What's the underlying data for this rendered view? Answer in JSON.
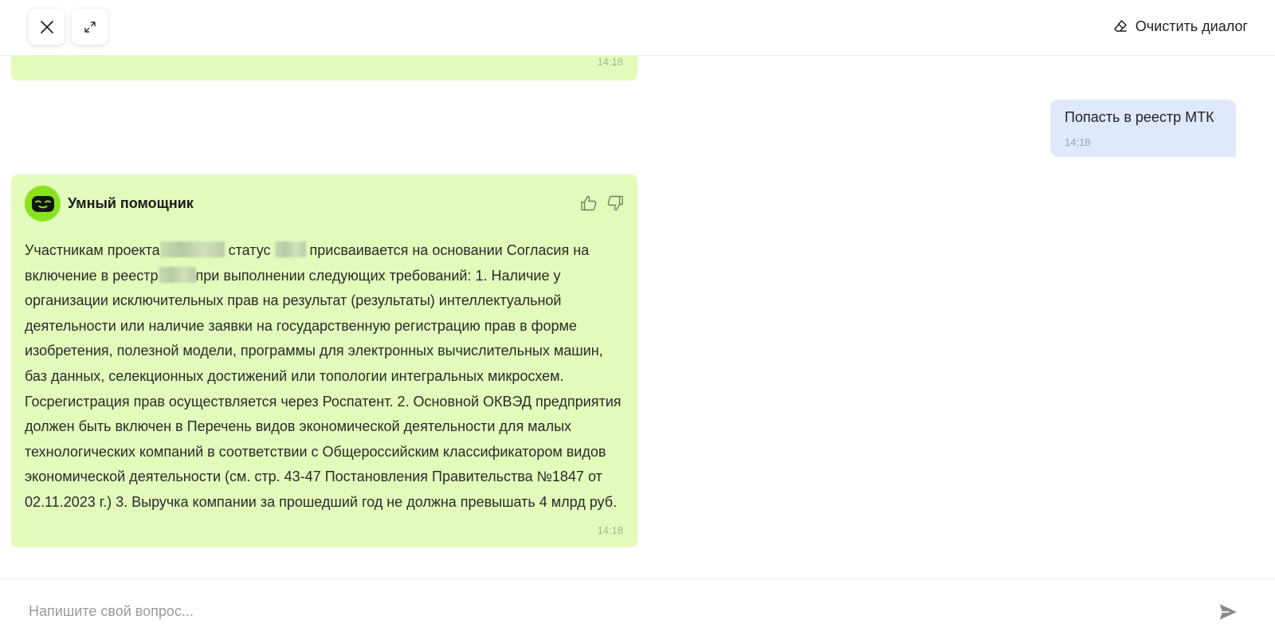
{
  "header": {
    "close_icon": "close-icon",
    "expand_icon": "expand-icon",
    "clear_label": "Очистить диалог",
    "clear_icon": "eraser-icon"
  },
  "messages": {
    "top_bot_time": "14:18",
    "user": {
      "text": "Попасть в реестр МТК",
      "time": "14:18"
    },
    "bot": {
      "name": "Умный помощник",
      "time": "14:18",
      "text_parts": [
        "Участникам проекта",
        " статус ",
        " присваивается на основании Согласия на включение в реестр",
        "при выполнении следующих требований: 1. Наличие у организации исключительных прав на результат (результаты) интеллектуальной деятельности или наличие заявки на государственную регистрацию прав в форме изобретения, полезной модели, программы для электронных вычислительных машин, баз данных, селекционных достижений или топологии интегральных микросхем. Госрегистрация прав осуществляется через Роспатент. 2. Основной ОКВЭД предприятия должен быть включен в Перечень видов экономической деятельности для малых технологических компаний в соответствии с Общероссийским классификатором видов экономической деятельности (см. стр. 43-47 Постановления Правительства №1847 от 02.11.2023 г.) 3. Выручка компании за прошедший год не должна превышать 4 млрд руб."
      ]
    }
  },
  "footer": {
    "placeholder": "Напишите свой вопрос...",
    "value": ""
  },
  "colors": {
    "bot_bubble": "#e2fbbb",
    "user_bubble": "#dfe8fd",
    "avatar": "#89e31c"
  }
}
